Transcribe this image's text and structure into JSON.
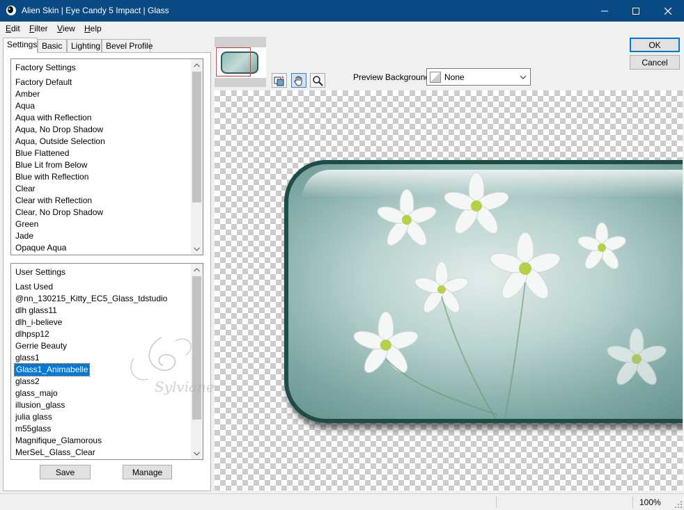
{
  "window": {
    "title": "Alien Skin | Eye Candy 5 Impact | Glass"
  },
  "menu": [
    "Edit",
    "Filter",
    "View",
    "Help"
  ],
  "tabs": [
    "Settings",
    "Basic",
    "Lighting",
    "Bevel Profile"
  ],
  "factory": {
    "header": "Factory Settings",
    "items": [
      "Factory Default",
      "Amber",
      "Aqua",
      "Aqua with Reflection",
      "Aqua, No Drop Shadow",
      "Aqua, Outside Selection",
      "Blue Flattened",
      "Blue Lit from Below",
      "Blue with Reflection",
      "Clear",
      "Clear with Reflection",
      "Clear, No Drop Shadow",
      "Green",
      "Jade",
      "Opaque Aqua"
    ]
  },
  "user": {
    "header": "User Settings",
    "items": [
      "Last Used",
      "@nn_130215_Kitty_EC5_Glass_tdstudio",
      "dlh glass11",
      "dlh_i-believe",
      "dlhpsp12",
      "Gerrie Beauty",
      "glass1",
      "Glass1_Animabelle",
      "glass2",
      "glass_majo",
      "illusion_glass",
      "julia glass",
      "m55glass",
      "Magnifique_Glamorous",
      "MerSeL_Glass_Clear"
    ],
    "selected_index": 7
  },
  "buttons": {
    "save": "Save",
    "manage": "Manage",
    "ok": "OK",
    "cancel": "Cancel"
  },
  "preview_background": {
    "label": "Preview Background:",
    "value": "None"
  },
  "watermark_text": "Sylviane",
  "status": {
    "zoom": "100%"
  }
}
